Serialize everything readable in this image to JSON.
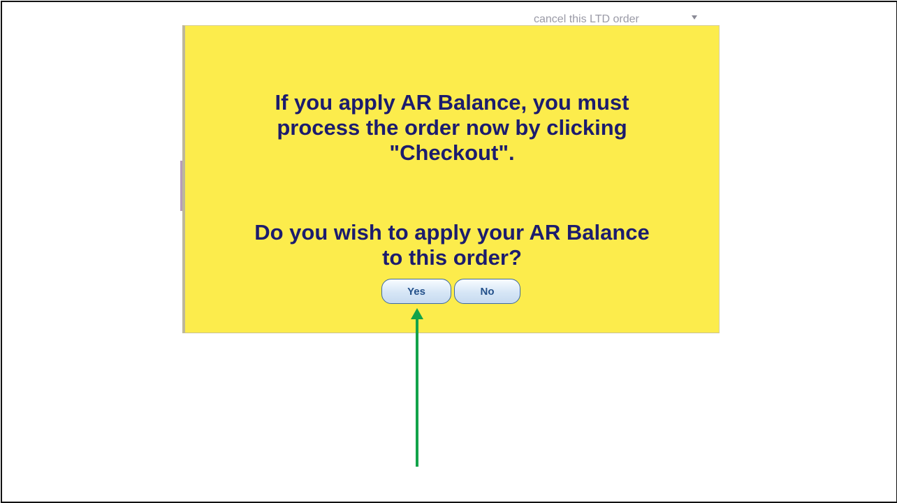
{
  "background": {
    "partial_text": "cancel this LTD order"
  },
  "dialog": {
    "message_line1": "If you apply AR Balance, you must",
    "message_line2": "process the order now by clicking",
    "message_line3": "\"Checkout\".",
    "question_line1": "Do you wish to apply your AR Balance",
    "question_line2": "to this order?",
    "yes_label": "Yes",
    "no_label": "No"
  },
  "annotation": {
    "arrow_color": "#12a34a",
    "points_to": "yes-button"
  },
  "colors": {
    "dialog_background": "#fcec4c",
    "message_text": "#1c1c6e",
    "button_text": "#23508a",
    "button_border": "#3e6aa0"
  }
}
